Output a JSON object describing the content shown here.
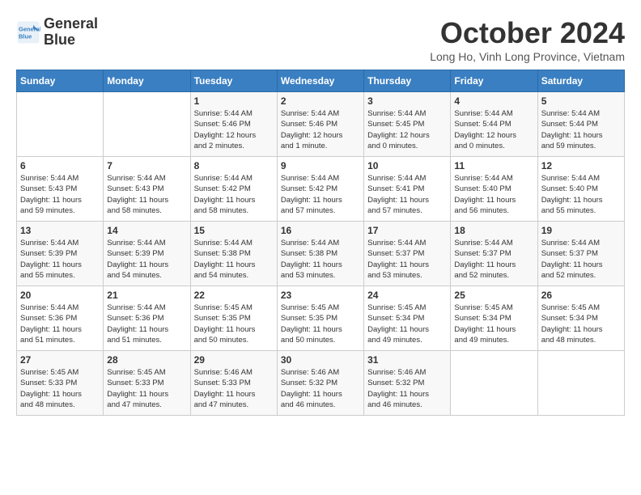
{
  "header": {
    "logo_line1": "General",
    "logo_line2": "Blue",
    "month_title": "October 2024",
    "location": "Long Ho, Vinh Long Province, Vietnam"
  },
  "days_of_week": [
    "Sunday",
    "Monday",
    "Tuesday",
    "Wednesday",
    "Thursday",
    "Friday",
    "Saturday"
  ],
  "weeks": [
    [
      {
        "day": "",
        "info": ""
      },
      {
        "day": "",
        "info": ""
      },
      {
        "day": "1",
        "info": "Sunrise: 5:44 AM\nSunset: 5:46 PM\nDaylight: 12 hours\nand 2 minutes."
      },
      {
        "day": "2",
        "info": "Sunrise: 5:44 AM\nSunset: 5:46 PM\nDaylight: 12 hours\nand 1 minute."
      },
      {
        "day": "3",
        "info": "Sunrise: 5:44 AM\nSunset: 5:45 PM\nDaylight: 12 hours\nand 0 minutes."
      },
      {
        "day": "4",
        "info": "Sunrise: 5:44 AM\nSunset: 5:44 PM\nDaylight: 12 hours\nand 0 minutes."
      },
      {
        "day": "5",
        "info": "Sunrise: 5:44 AM\nSunset: 5:44 PM\nDaylight: 11 hours\nand 59 minutes."
      }
    ],
    [
      {
        "day": "6",
        "info": "Sunrise: 5:44 AM\nSunset: 5:43 PM\nDaylight: 11 hours\nand 59 minutes."
      },
      {
        "day": "7",
        "info": "Sunrise: 5:44 AM\nSunset: 5:43 PM\nDaylight: 11 hours\nand 58 minutes."
      },
      {
        "day": "8",
        "info": "Sunrise: 5:44 AM\nSunset: 5:42 PM\nDaylight: 11 hours\nand 58 minutes."
      },
      {
        "day": "9",
        "info": "Sunrise: 5:44 AM\nSunset: 5:42 PM\nDaylight: 11 hours\nand 57 minutes."
      },
      {
        "day": "10",
        "info": "Sunrise: 5:44 AM\nSunset: 5:41 PM\nDaylight: 11 hours\nand 57 minutes."
      },
      {
        "day": "11",
        "info": "Sunrise: 5:44 AM\nSunset: 5:40 PM\nDaylight: 11 hours\nand 56 minutes."
      },
      {
        "day": "12",
        "info": "Sunrise: 5:44 AM\nSunset: 5:40 PM\nDaylight: 11 hours\nand 55 minutes."
      }
    ],
    [
      {
        "day": "13",
        "info": "Sunrise: 5:44 AM\nSunset: 5:39 PM\nDaylight: 11 hours\nand 55 minutes."
      },
      {
        "day": "14",
        "info": "Sunrise: 5:44 AM\nSunset: 5:39 PM\nDaylight: 11 hours\nand 54 minutes."
      },
      {
        "day": "15",
        "info": "Sunrise: 5:44 AM\nSunset: 5:38 PM\nDaylight: 11 hours\nand 54 minutes."
      },
      {
        "day": "16",
        "info": "Sunrise: 5:44 AM\nSunset: 5:38 PM\nDaylight: 11 hours\nand 53 minutes."
      },
      {
        "day": "17",
        "info": "Sunrise: 5:44 AM\nSunset: 5:37 PM\nDaylight: 11 hours\nand 53 minutes."
      },
      {
        "day": "18",
        "info": "Sunrise: 5:44 AM\nSunset: 5:37 PM\nDaylight: 11 hours\nand 52 minutes."
      },
      {
        "day": "19",
        "info": "Sunrise: 5:44 AM\nSunset: 5:37 PM\nDaylight: 11 hours\nand 52 minutes."
      }
    ],
    [
      {
        "day": "20",
        "info": "Sunrise: 5:44 AM\nSunset: 5:36 PM\nDaylight: 11 hours\nand 51 minutes."
      },
      {
        "day": "21",
        "info": "Sunrise: 5:44 AM\nSunset: 5:36 PM\nDaylight: 11 hours\nand 51 minutes."
      },
      {
        "day": "22",
        "info": "Sunrise: 5:45 AM\nSunset: 5:35 PM\nDaylight: 11 hours\nand 50 minutes."
      },
      {
        "day": "23",
        "info": "Sunrise: 5:45 AM\nSunset: 5:35 PM\nDaylight: 11 hours\nand 50 minutes."
      },
      {
        "day": "24",
        "info": "Sunrise: 5:45 AM\nSunset: 5:34 PM\nDaylight: 11 hours\nand 49 minutes."
      },
      {
        "day": "25",
        "info": "Sunrise: 5:45 AM\nSunset: 5:34 PM\nDaylight: 11 hours\nand 49 minutes."
      },
      {
        "day": "26",
        "info": "Sunrise: 5:45 AM\nSunset: 5:34 PM\nDaylight: 11 hours\nand 48 minutes."
      }
    ],
    [
      {
        "day": "27",
        "info": "Sunrise: 5:45 AM\nSunset: 5:33 PM\nDaylight: 11 hours\nand 48 minutes."
      },
      {
        "day": "28",
        "info": "Sunrise: 5:45 AM\nSunset: 5:33 PM\nDaylight: 11 hours\nand 47 minutes."
      },
      {
        "day": "29",
        "info": "Sunrise: 5:46 AM\nSunset: 5:33 PM\nDaylight: 11 hours\nand 47 minutes."
      },
      {
        "day": "30",
        "info": "Sunrise: 5:46 AM\nSunset: 5:32 PM\nDaylight: 11 hours\nand 46 minutes."
      },
      {
        "day": "31",
        "info": "Sunrise: 5:46 AM\nSunset: 5:32 PM\nDaylight: 11 hours\nand 46 minutes."
      },
      {
        "day": "",
        "info": ""
      },
      {
        "day": "",
        "info": ""
      }
    ]
  ]
}
